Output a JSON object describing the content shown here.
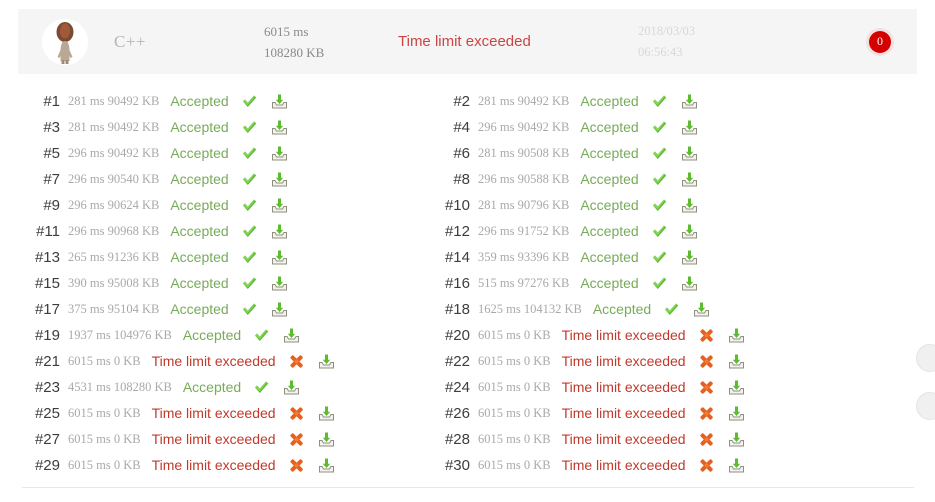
{
  "header": {
    "avatar_icon": "user-avatar-image",
    "language": "C++",
    "time": "6015 ms",
    "memory": "108280 KB",
    "status": "Time limit exceeded",
    "status_color": "#cc4444",
    "date": "2018/03/03",
    "clock": "06:56:43",
    "score": "0",
    "score_badge_color": "#d40000"
  },
  "colors": {
    "accepted": "#77ab59",
    "time_limit_exceeded": "#c0392b",
    "panel_background": "#f5f5f5",
    "metric_text": "#a9a9a9"
  },
  "status_labels": {
    "accepted": "Accepted",
    "tle": "Time limit exceeded"
  },
  "icons": {
    "accepted": "green-check-icon",
    "failed": "orange-cross-burst-icon",
    "download": "download-tray-icon"
  },
  "tests": {
    "left": [
      {
        "num": "#1",
        "metrics": "281 ms 90492 KB",
        "status": "Accepted",
        "state": "accepted"
      },
      {
        "num": "#3",
        "metrics": "281 ms 90492 KB",
        "status": "Accepted",
        "state": "accepted"
      },
      {
        "num": "#5",
        "metrics": "296 ms 90492 KB",
        "status": "Accepted",
        "state": "accepted"
      },
      {
        "num": "#7",
        "metrics": "296 ms 90540 KB",
        "status": "Accepted",
        "state": "accepted"
      },
      {
        "num": "#9",
        "metrics": "296 ms 90624 KB",
        "status": "Accepted",
        "state": "accepted"
      },
      {
        "num": "#11",
        "metrics": "296 ms 90968 KB",
        "status": "Accepted",
        "state": "accepted"
      },
      {
        "num": "#13",
        "metrics": "265 ms 91236 KB",
        "status": "Accepted",
        "state": "accepted"
      },
      {
        "num": "#15",
        "metrics": "390 ms 95008 KB",
        "status": "Accepted",
        "state": "accepted"
      },
      {
        "num": "#17",
        "metrics": "375 ms 95104 KB",
        "status": "Accepted",
        "state": "accepted"
      },
      {
        "num": "#19",
        "metrics": "1937 ms 104976 KB",
        "status": "Accepted",
        "state": "accepted"
      },
      {
        "num": "#21",
        "metrics": "6015 ms 0 KB",
        "status": "Time limit exceeded",
        "state": "tle"
      },
      {
        "num": "#23",
        "metrics": "4531 ms 108280 KB",
        "status": "Accepted",
        "state": "accepted"
      },
      {
        "num": "#25",
        "metrics": "6015 ms 0 KB",
        "status": "Time limit exceeded",
        "state": "tle"
      },
      {
        "num": "#27",
        "metrics": "6015 ms 0 KB",
        "status": "Time limit exceeded",
        "state": "tle"
      },
      {
        "num": "#29",
        "metrics": "6015 ms 0 KB",
        "status": "Time limit exceeded",
        "state": "tle"
      }
    ],
    "right": [
      {
        "num": "#2",
        "metrics": "281 ms 90492 KB",
        "status": "Accepted",
        "state": "accepted"
      },
      {
        "num": "#4",
        "metrics": "296 ms 90492 KB",
        "status": "Accepted",
        "state": "accepted"
      },
      {
        "num": "#6",
        "metrics": "281 ms 90508 KB",
        "status": "Accepted",
        "state": "accepted"
      },
      {
        "num": "#8",
        "metrics": "296 ms 90588 KB",
        "status": "Accepted",
        "state": "accepted"
      },
      {
        "num": "#10",
        "metrics": "281 ms 90796 KB",
        "status": "Accepted",
        "state": "accepted"
      },
      {
        "num": "#12",
        "metrics": "296 ms 91752 KB",
        "status": "Accepted",
        "state": "accepted"
      },
      {
        "num": "#14",
        "metrics": "359 ms 93396 KB",
        "status": "Accepted",
        "state": "accepted"
      },
      {
        "num": "#16",
        "metrics": "515 ms 97276 KB",
        "status": "Accepted",
        "state": "accepted"
      },
      {
        "num": "#18",
        "metrics": "1625 ms 104132 KB",
        "status": "Accepted",
        "state": "accepted"
      },
      {
        "num": "#20",
        "metrics": "6015 ms 0 KB",
        "status": "Time limit exceeded",
        "state": "tle"
      },
      {
        "num": "#22",
        "metrics": "6015 ms 0 KB",
        "status": "Time limit exceeded",
        "state": "tle"
      },
      {
        "num": "#24",
        "metrics": "6015 ms 0 KB",
        "status": "Time limit exceeded",
        "state": "tle"
      },
      {
        "num": "#26",
        "metrics": "6015 ms 0 KB",
        "status": "Time limit exceeded",
        "state": "tle"
      },
      {
        "num": "#28",
        "metrics": "6015 ms 0 KB",
        "status": "Time limit exceeded",
        "state": "tle"
      },
      {
        "num": "#30",
        "metrics": "6015 ms 0 KB",
        "status": "Time limit exceeded",
        "state": "tle"
      }
    ]
  }
}
